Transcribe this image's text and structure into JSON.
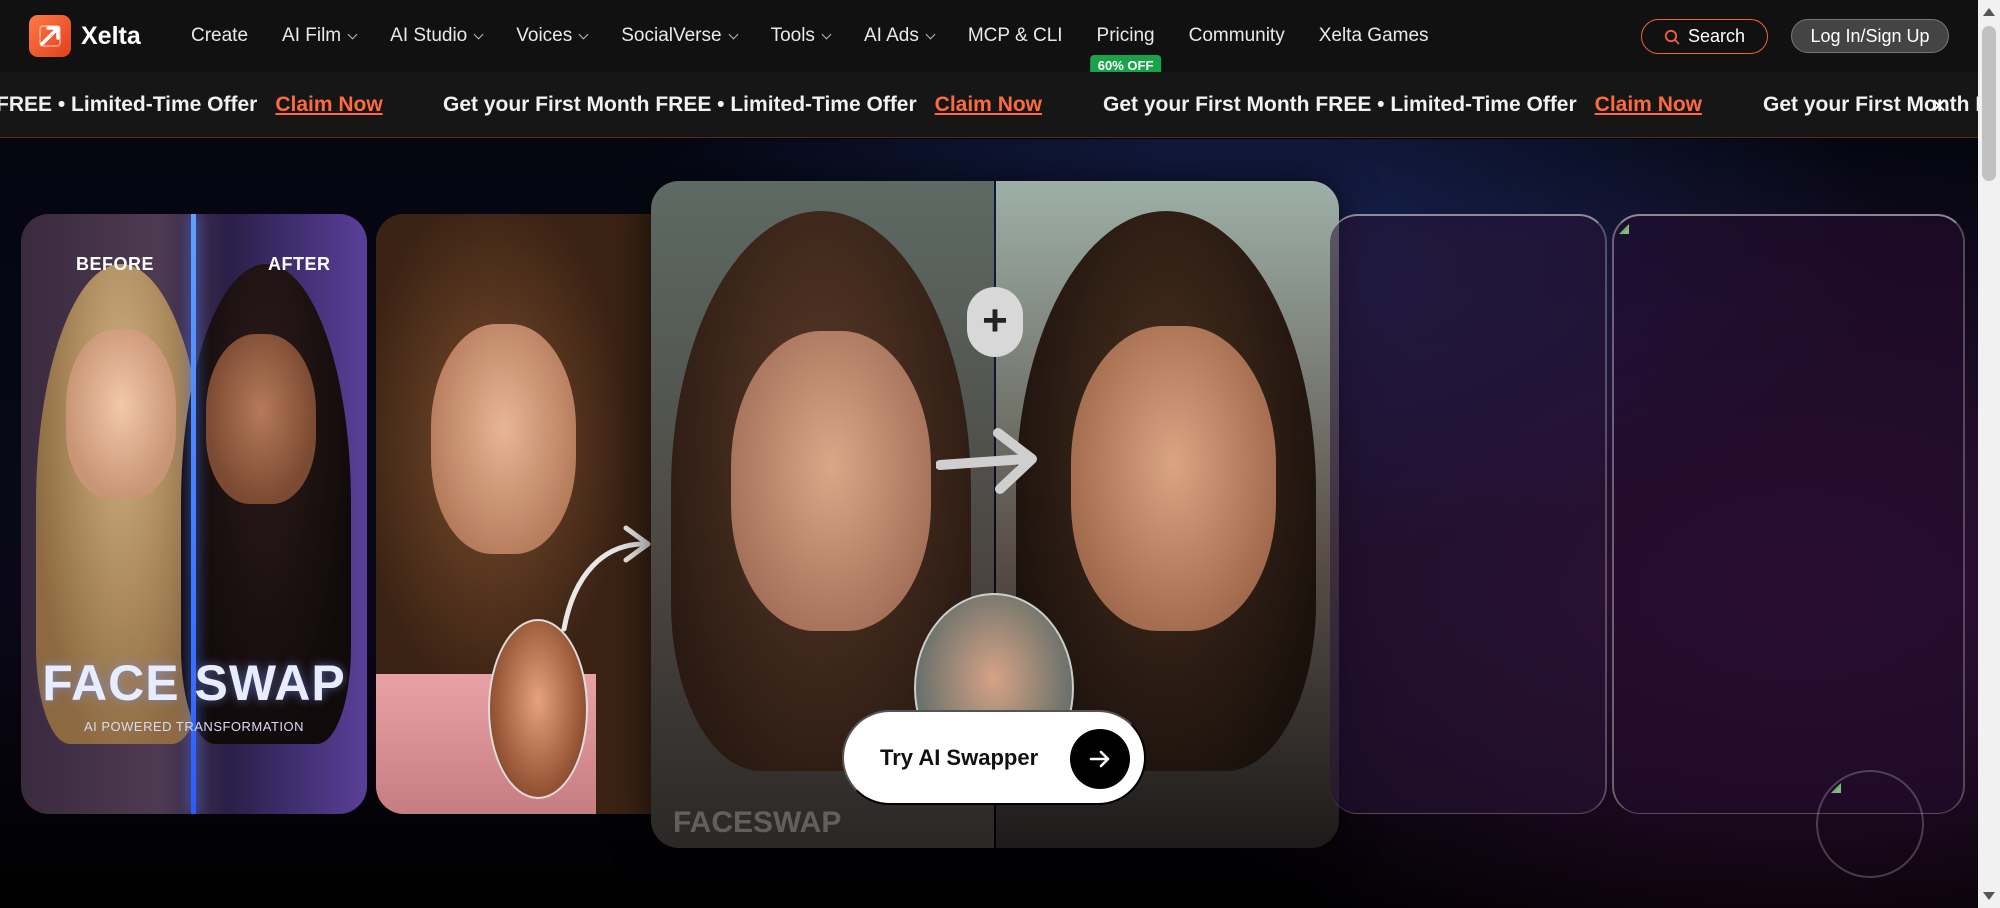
{
  "brand": {
    "name": "Xelta"
  },
  "nav": {
    "items": [
      {
        "label": "Create",
        "dropdown": false
      },
      {
        "label": "AI Film",
        "dropdown": true
      },
      {
        "label": "AI Studio",
        "dropdown": true
      },
      {
        "label": "Voices",
        "dropdown": true
      },
      {
        "label": "SocialVerse",
        "dropdown": true
      },
      {
        "label": "Tools",
        "dropdown": true
      },
      {
        "label": "AI Ads",
        "dropdown": true
      },
      {
        "label": "MCP & CLI",
        "dropdown": false
      },
      {
        "label": "Pricing",
        "dropdown": false,
        "badge": "60% OFF"
      },
      {
        "label": "Community",
        "dropdown": false
      },
      {
        "label": "Xelta Games",
        "dropdown": false
      }
    ],
    "search_label": "Search",
    "login_label": "Log In/Sign Up"
  },
  "promo": {
    "lead_fragment": "FREE • Limited-Time Offer",
    "message": "Get your First Month FREE • Limited-Time Offer",
    "tail_fragment": "Get your First Month F",
    "claim_label": "Claim Now",
    "close_glyph": "×"
  },
  "hero": {
    "card1": {
      "before_label": "BEFORE",
      "after_label": "AFTER",
      "title": "FACE SWAP",
      "subtitle": "AI POWERED TRANSFORMATION"
    },
    "card3": {
      "plus_glyph": "+",
      "watermark": "FACESWAP"
    },
    "cta_label": "Try AI Swapper"
  },
  "colors": {
    "accent": "#ff6a3d",
    "badge": "#1aa34a",
    "navbar": "#111111",
    "promo_bar": "#161616"
  }
}
